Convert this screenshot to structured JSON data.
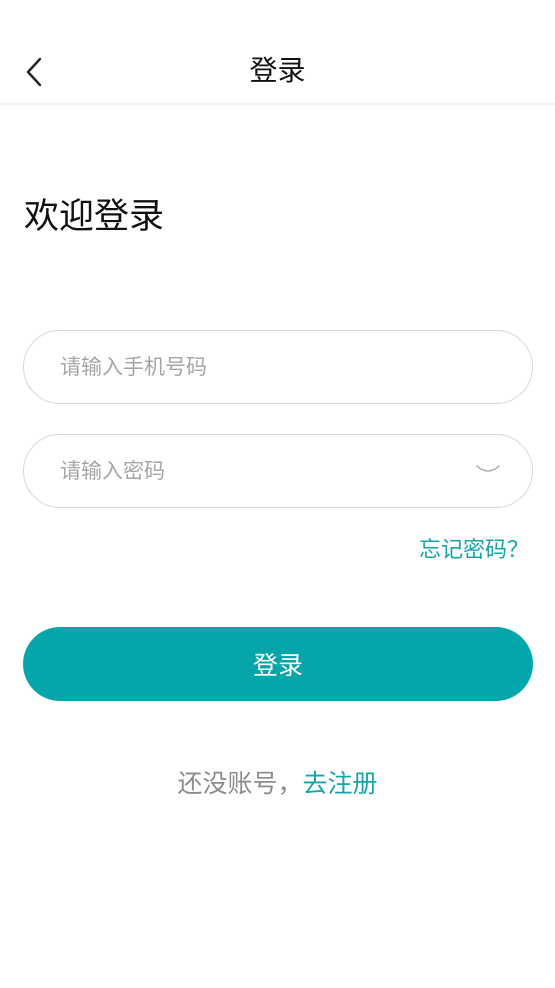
{
  "nav": {
    "title": "登录",
    "back_icon": "chevron-left-icon"
  },
  "welcome": "欢迎登录",
  "form": {
    "phone_placeholder": "请输入手机号码",
    "password_placeholder": "请输入密码",
    "toggle_icon": "eye-closed-icon",
    "forgot": "忘记密码？",
    "submit": "登录"
  },
  "register": {
    "prompt": "还没账号，",
    "link": "去注册"
  },
  "colors": {
    "accent": "#06a5aa",
    "link": "#1aa3a8",
    "placeholder": "#a6a6a6",
    "border": "#d6d6d6"
  }
}
